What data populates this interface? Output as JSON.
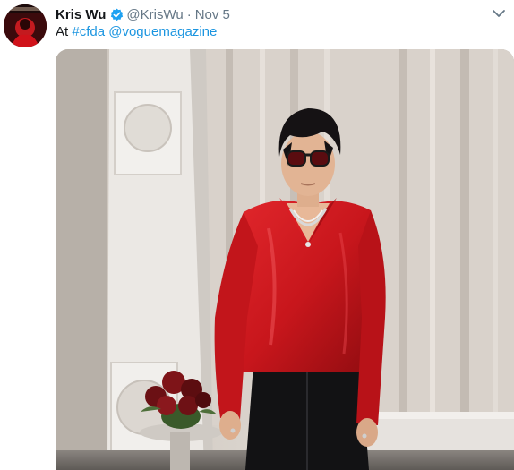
{
  "tweet": {
    "author_name": "Kris Wu",
    "handle": "@KrisWu",
    "separator": "·",
    "date": "Nov 5",
    "text_prefix": "At",
    "hashtag": "#cfda",
    "mention": "@voguemagazine"
  },
  "colors": {
    "link": "#1b95e0",
    "secondary_text": "#657786",
    "verified_badge": "#1da1f2",
    "shirt_red": "#c8161c"
  },
  "icons": {
    "verified": "verified-badge-icon",
    "more": "chevron-down-icon"
  }
}
